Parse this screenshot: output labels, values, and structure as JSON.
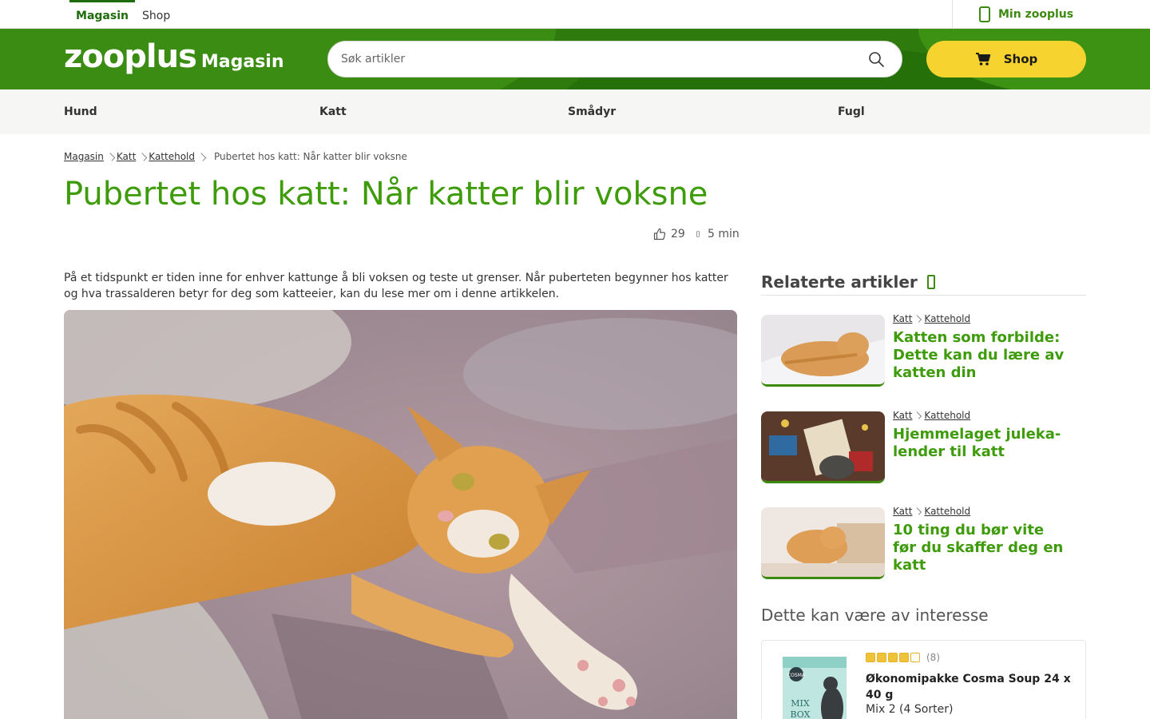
{
  "topbar": {
    "tab_magasin": "Magasin",
    "tab_shop": "Shop",
    "account_label": "Min zooplus"
  },
  "header": {
    "logo_brand": "zooplus",
    "logo_suffix": "Magasin",
    "search_placeholder": "Søk artikler",
    "shop_button": "Shop"
  },
  "category_nav": [
    "Hund",
    "Katt",
    "Smådyr",
    "Fugl"
  ],
  "breadcrumb": {
    "items": [
      "Magasin",
      "Katt",
      "Kattehold"
    ],
    "current": "Pubertet hos katt: Når katter blir voksne"
  },
  "article": {
    "title": "Pubertet hos katt: Når katter blir voksne",
    "likes": "29",
    "read_time": "5 min",
    "intro": "På et tidspunkt er tiden inne for enhver kattunge å bli voksen og teste ut grenser. Når puberteten begynner hos katter og hva trassalderen betyr for deg som katteeier, kan du lese mer om i denne artikkelen."
  },
  "related": {
    "heading": "Relaterte artikler",
    "items": [
      {
        "cat": "Katt",
        "subcat": "Kattehold",
        "title": "Katten som forbilde: Dette kan du lære av katten din"
      },
      {
        "cat": "Katt",
        "subcat": "Kattehold",
        "title": "Hjemmelaget juleka-lender til katt"
      },
      {
        "cat": "Katt",
        "subcat": "Kattehold",
        "title": "10 ting du bør vite før du skaffer deg en katt"
      }
    ]
  },
  "interest": {
    "heading": "Dette kan være av interesse",
    "product": {
      "rating": 4,
      "review_count": "(8)",
      "name": "Økonomipakke Cosma Soup 24 x 40 g",
      "variant": "Mix 2 (4 Sorter)"
    }
  },
  "colors": {
    "brand_green": "#2f7a0d",
    "title_green": "#3e9b0a",
    "shop_yellow": "#f6d32f"
  }
}
